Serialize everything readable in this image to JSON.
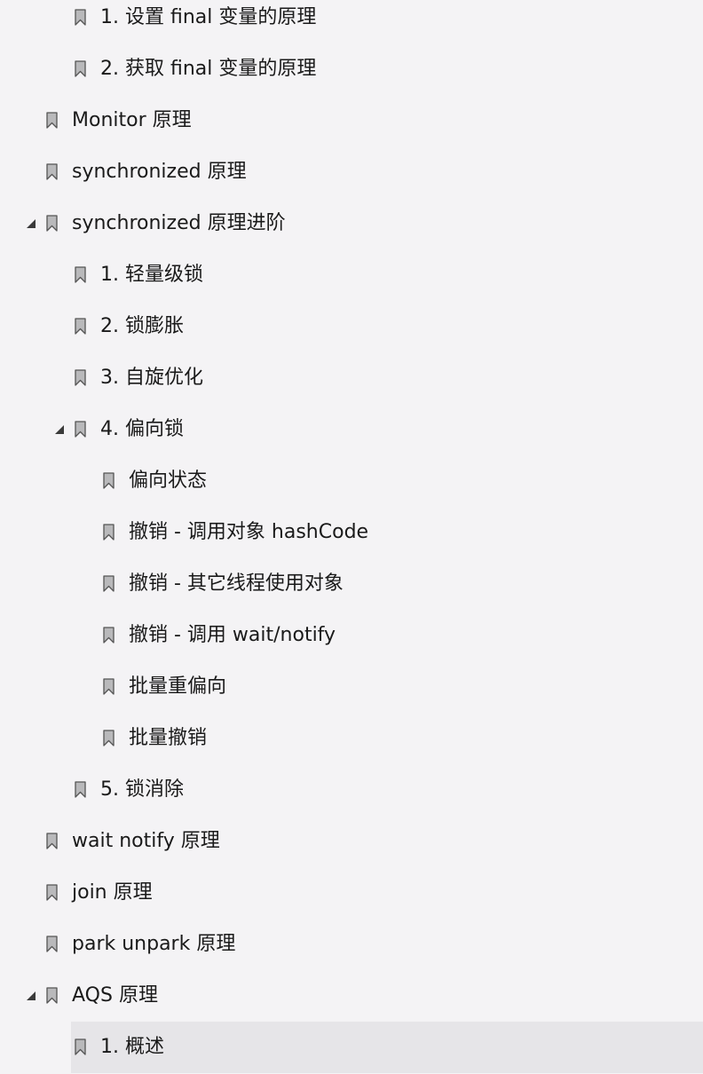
{
  "bookmarks": [
    {
      "label": "1. 设置 final 变量的原理",
      "level": 2,
      "expanded": null,
      "selected": false
    },
    {
      "label": "2. 获取 final 变量的原理",
      "level": 2,
      "expanded": null,
      "selected": false
    },
    {
      "label": "Monitor 原理",
      "level": 1,
      "expanded": null,
      "selected": false
    },
    {
      "label": "synchronized 原理",
      "level": 1,
      "expanded": null,
      "selected": false
    },
    {
      "label": "synchronized 原理进阶",
      "level": 1,
      "expanded": true,
      "selected": false
    },
    {
      "label": "1. 轻量级锁",
      "level": 2,
      "expanded": null,
      "selected": false
    },
    {
      "label": "2. 锁膨胀",
      "level": 2,
      "expanded": null,
      "selected": false
    },
    {
      "label": "3. 自旋优化",
      "level": 2,
      "expanded": null,
      "selected": false
    },
    {
      "label": "4. 偏向锁",
      "level": 2,
      "expanded": true,
      "selected": false
    },
    {
      "label": "偏向状态",
      "level": 3,
      "expanded": null,
      "selected": false
    },
    {
      "label": "撤销 - 调用对象 hashCode",
      "level": 3,
      "expanded": null,
      "selected": false
    },
    {
      "label": "撤销 - 其它线程使用对象",
      "level": 3,
      "expanded": null,
      "selected": false
    },
    {
      "label": "撤销 - 调用 wait/notify",
      "level": 3,
      "expanded": null,
      "selected": false
    },
    {
      "label": "批量重偏向",
      "level": 3,
      "expanded": null,
      "selected": false
    },
    {
      "label": "批量撤销",
      "level": 3,
      "expanded": null,
      "selected": false
    },
    {
      "label": "5. 锁消除",
      "level": 2,
      "expanded": null,
      "selected": false
    },
    {
      "label": "wait notify 原理",
      "level": 1,
      "expanded": null,
      "selected": false
    },
    {
      "label": "join 原理",
      "level": 1,
      "expanded": null,
      "selected": false
    },
    {
      "label": "park unpark 原理",
      "level": 1,
      "expanded": null,
      "selected": false
    },
    {
      "label": "AQS 原理",
      "level": 1,
      "expanded": true,
      "selected": false
    },
    {
      "label": "1. 概述",
      "level": 2,
      "expanded": null,
      "selected": true
    }
  ],
  "icons": {
    "bookmark": "bookmark-icon",
    "expanded": "triangle-expanded-icon"
  },
  "colors": {
    "background": "#f4f3f5",
    "selected": "#e6e5e8",
    "bookmark_fill": "#b9b9bb",
    "bookmark_stroke": "#555555",
    "text": "#1a1a1a"
  }
}
